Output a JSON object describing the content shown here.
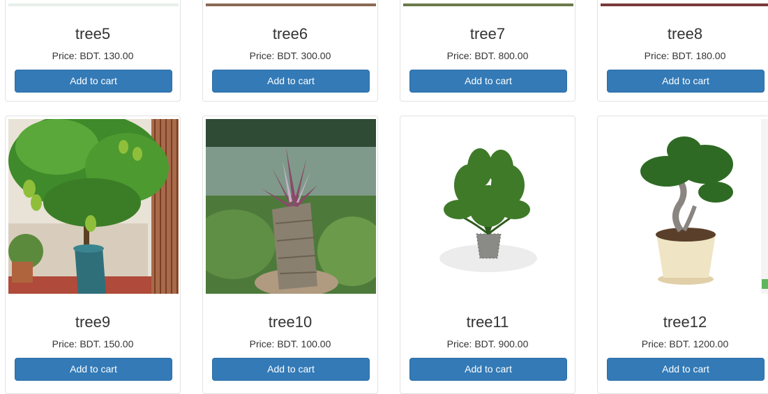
{
  "cart_button_label": "Add to cart",
  "price_prefix": "Price: ",
  "row1": [
    {
      "name": "tree5",
      "price": "BDT. 130.00"
    },
    {
      "name": "tree6",
      "price": "BDT. 300.00"
    },
    {
      "name": "tree7",
      "price": "BDT. 800.00"
    },
    {
      "name": "tree8",
      "price": "BDT. 180.00"
    }
  ],
  "row2": [
    {
      "name": "tree9",
      "price": "BDT. 150.00"
    },
    {
      "name": "tree10",
      "price": "BDT. 100.00"
    },
    {
      "name": "tree11",
      "price": "BDT. 900.00"
    },
    {
      "name": "tree12",
      "price": "BDT. 1200.00"
    }
  ],
  "colors": {
    "button": "#337ab7",
    "button_border": "#2e6da4",
    "card_border": "#e2e2e2"
  }
}
